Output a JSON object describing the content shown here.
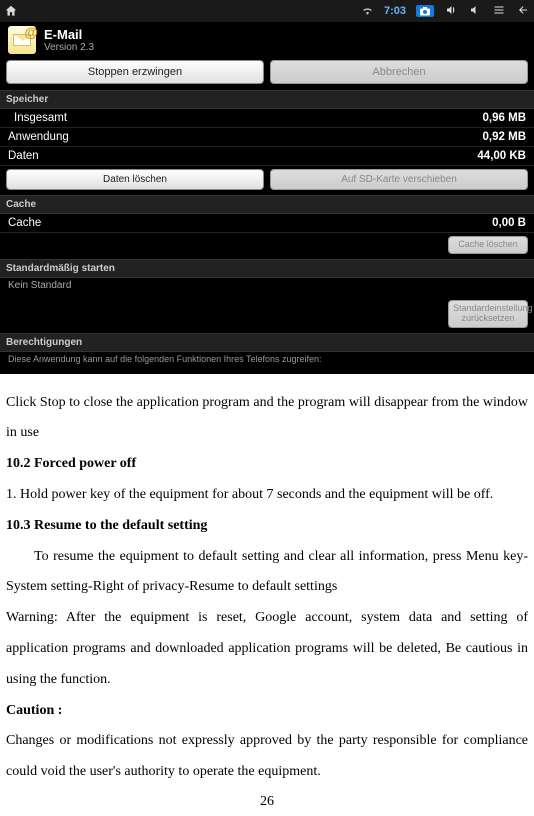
{
  "statusbar": {
    "time": "7:03"
  },
  "app": {
    "title": "E-Mail",
    "version": "Version 2.3"
  },
  "top_buttons": {
    "force_stop": "Stoppen erzwingen",
    "cancel": "Abbrechen"
  },
  "storage": {
    "header": "Speicher",
    "total_label": "Insgesamt",
    "total_value": "0,96 MB",
    "app_label": "Anwendung",
    "app_value": "0,92 MB",
    "data_label": "Daten",
    "data_value": "44,00 KB",
    "clear_data": "Daten löschen",
    "move_sd": "Auf SD-Karte verschieben"
  },
  "cache": {
    "header": "Cache",
    "label": "Cache",
    "value": "0,00 B",
    "clear": "Cache löschen"
  },
  "defaults": {
    "header": "Standardmäßig starten",
    "none": "Kein Standard",
    "reset": "Standardeinstellung zurücksetzen"
  },
  "permissions": {
    "header": "Berechtigungen",
    "note": "Diese Anwendung kann auf die folgenden Funktionen Ihres Telefons zugreifen:"
  },
  "doc": {
    "p1": "Click Stop to close the application program and the program will disappear from the window in use",
    "h1": "10.2 Forced power off",
    "p2": "1. Hold power key of the equipment for about 7 seconds and the equipment will be off.",
    "h2": "10.3 Resume to the default setting",
    "p3": "To resume the equipment to default setting and clear all information, press Menu key-System setting-Right of privacy-Resume to default settings",
    "p4": "Warning: After the equipment is reset, Google account, system data and setting of application programs and downloaded application programs will be deleted, Be cautious in using the function.",
    "h3": "Caution :",
    "p5": "Changes or modifications not expressly approved by the party responsible for compliance could void the user's authority to operate the equipment.",
    "page": "26"
  }
}
